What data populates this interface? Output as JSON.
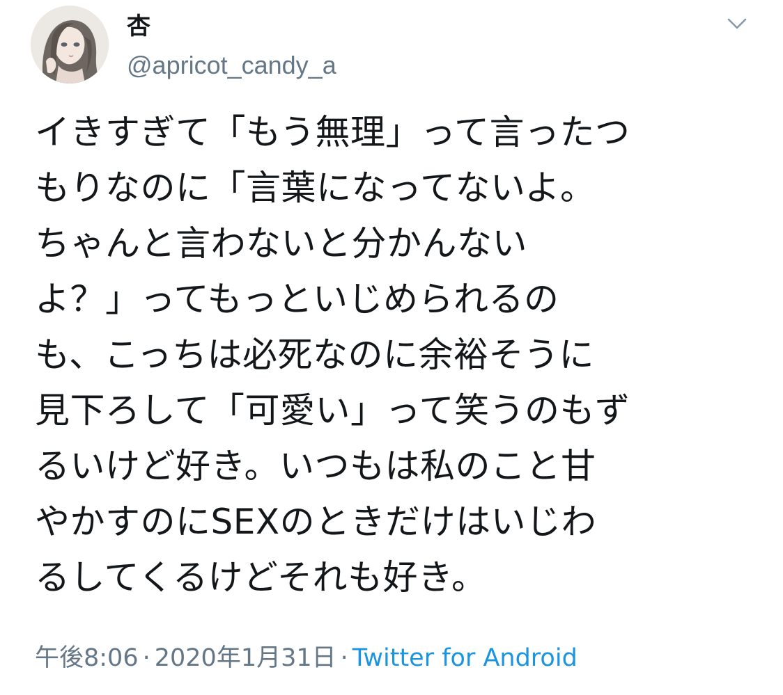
{
  "tweet": {
    "author": {
      "display_name": "杏",
      "handle": "@apricot_candy_a",
      "avatar_icon": "profile-avatar"
    },
    "menu_icon": "chevron-down-icon",
    "text_lines": [
      "イきすぎて「もう無理」って言ったつ",
      "もりなのに「言葉になってないよ。",
      "ちゃんと言わないと分かんない",
      "よ？」ってもっといじめられるの",
      "も、こっちは必死なのに余裕そうに",
      "見下ろして「可愛い」って笑うのもず",
      "るいけど好き。いつもは私のこと甘",
      "やかすのにSEXのときだけはいじわ",
      "るしてくるけどそれも好き。"
    ],
    "time": "午後8:06",
    "separator": "·",
    "date": "2020年1月31日",
    "source": "Twitter for Android"
  },
  "colors": {
    "text": "#14171a",
    "secondary": "#657786",
    "link": "#1b95e0"
  }
}
